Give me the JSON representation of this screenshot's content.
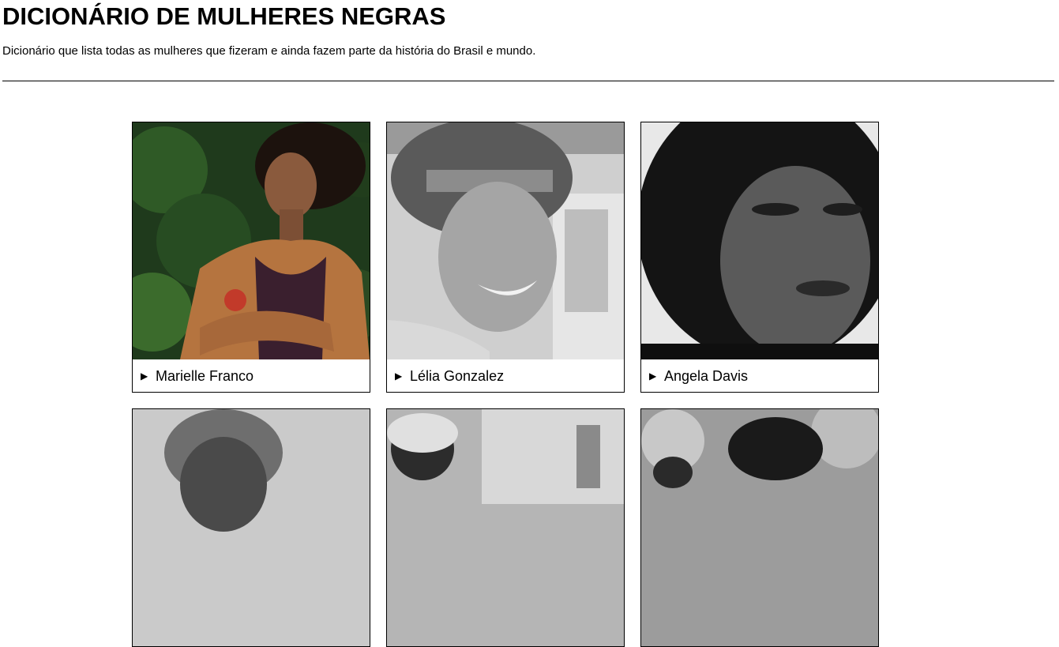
{
  "header": {
    "title": "DICIONÁRIO DE MULHERES NEGRAS",
    "subtitle": "Dicionário que lista todas as mulheres que fizeram e ainda fazem parte da história do Brasil e mundo."
  },
  "cards": [
    {
      "name": "Marielle Franco",
      "arrow": "▶"
    },
    {
      "name": "Lélia Gonzalez",
      "arrow": "▶"
    },
    {
      "name": "Angela Davis",
      "arrow": "▶"
    },
    {
      "name": "",
      "arrow": ""
    },
    {
      "name": "",
      "arrow": ""
    },
    {
      "name": "",
      "arrow": ""
    }
  ],
  "colors": {
    "text": "#000000",
    "background": "#ffffff",
    "border": "#000000"
  },
  "icons": {
    "caption_toggle": "triangle-right-icon"
  }
}
